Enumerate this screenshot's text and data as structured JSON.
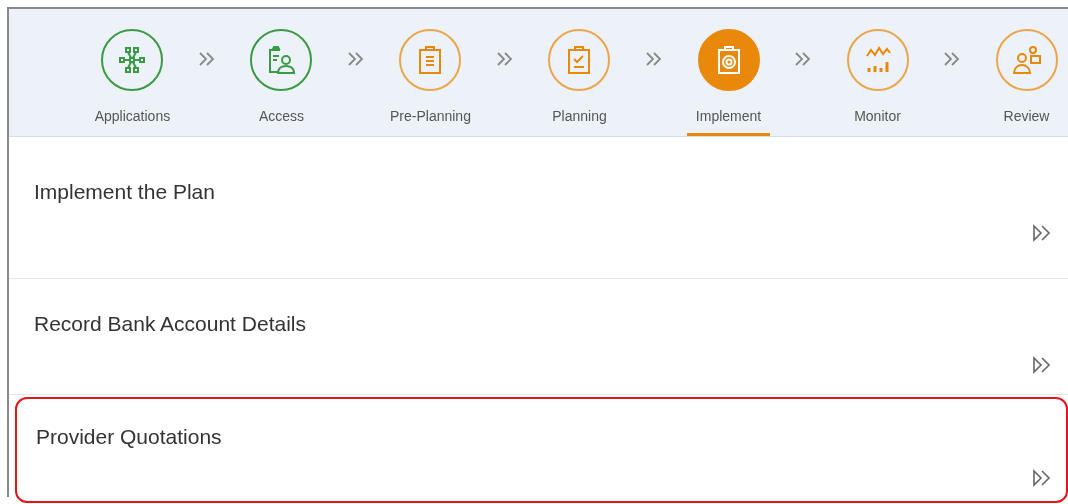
{
  "steps": [
    {
      "label": "Applications",
      "completed": true,
      "selected": false
    },
    {
      "label": "Access",
      "completed": true,
      "selected": false
    },
    {
      "label": "Pre-Planning",
      "completed": false,
      "selected": false
    },
    {
      "label": "Planning",
      "completed": false,
      "selected": false
    },
    {
      "label": "Implement",
      "completed": false,
      "selected": true
    },
    {
      "label": "Monitor",
      "completed": false,
      "selected": false
    },
    {
      "label": "Review",
      "completed": false,
      "selected": false
    }
  ],
  "tasks": [
    {
      "title": "Implement the Plan",
      "highlighted": false
    },
    {
      "title": "Record Bank Account Details",
      "highlighted": false
    },
    {
      "title": "Provider Quotations",
      "highlighted": true
    }
  ]
}
